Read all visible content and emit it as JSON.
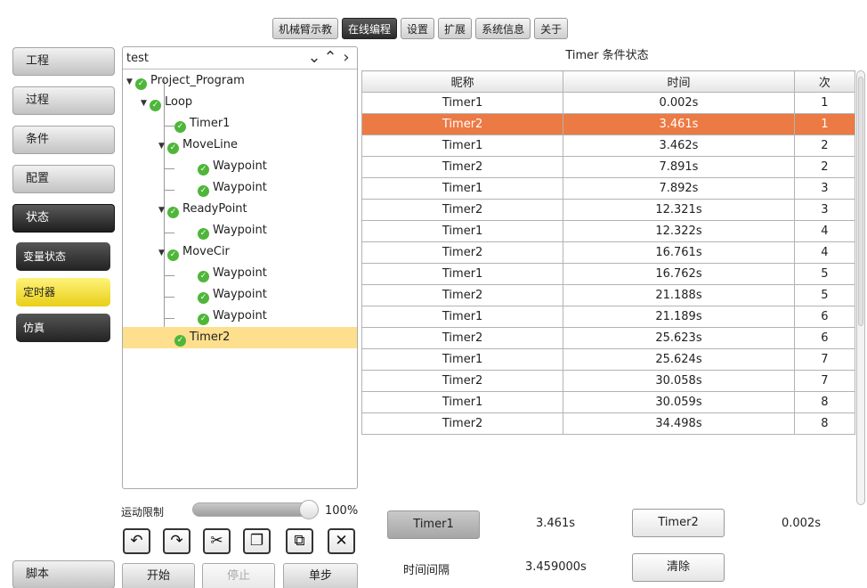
{
  "top_tabs": [
    "机械臂示教",
    "在线编程",
    "设置",
    "扩展",
    "系统信息",
    "关于"
  ],
  "sidebar": {
    "items": [
      "工程",
      "过程",
      "条件",
      "配置",
      "状态"
    ],
    "sub_items": [
      "变量状态",
      "定时器",
      "仿真"
    ],
    "script": "脚本"
  },
  "program": {
    "name": "test",
    "nodes": [
      "Project_Program",
      "Loop",
      "Timer1",
      "MoveLine",
      "Waypoint",
      "Waypoint",
      "ReadyPoint",
      "Waypoint",
      "MoveCir",
      "Waypoint",
      "Waypoint",
      "Waypoint",
      "Timer2"
    ]
  },
  "speed": {
    "label": "运动限制",
    "value": "100%",
    "level": 1.0
  },
  "controls": {
    "start": "开始",
    "stop": "停止",
    "step": "单步"
  },
  "timer_table": {
    "title": "Timer 条件状态",
    "columns": [
      "昵称",
      "时间",
      "次"
    ],
    "rows": [
      [
        "Timer1",
        "0.002s",
        "1"
      ],
      [
        "Timer2",
        "3.461s",
        "1"
      ],
      [
        "Timer1",
        "3.462s",
        "2"
      ],
      [
        "Timer2",
        "7.891s",
        "2"
      ],
      [
        "Timer1",
        "7.892s",
        "3"
      ],
      [
        "Timer2",
        "12.321s",
        "3"
      ],
      [
        "Timer1",
        "12.322s",
        "4"
      ],
      [
        "Timer2",
        "16.761s",
        "4"
      ],
      [
        "Timer1",
        "16.762s",
        "5"
      ],
      [
        "Timer2",
        "21.188s",
        "5"
      ],
      [
        "Timer1",
        "21.189s",
        "6"
      ],
      [
        "Timer2",
        "25.623s",
        "6"
      ],
      [
        "Timer1",
        "25.624s",
        "7"
      ],
      [
        "Timer2",
        "30.058s",
        "7"
      ],
      [
        "Timer1",
        "30.059s",
        "8"
      ],
      [
        "Timer2",
        "34.498s",
        "8"
      ]
    ]
  },
  "timer_controls": {
    "timer1_label": "Timer1",
    "timer1_value": "3.461s",
    "timer2_label": "Timer2",
    "timer2_value": "0.002s",
    "interval_label": "时间间隔",
    "interval_value": "3.459000s",
    "clear_label": "清除"
  },
  "colors": {
    "highlight_row": "#ec7a44",
    "selected_node": "#fddf8e",
    "active_sub": "#f3e03a"
  }
}
